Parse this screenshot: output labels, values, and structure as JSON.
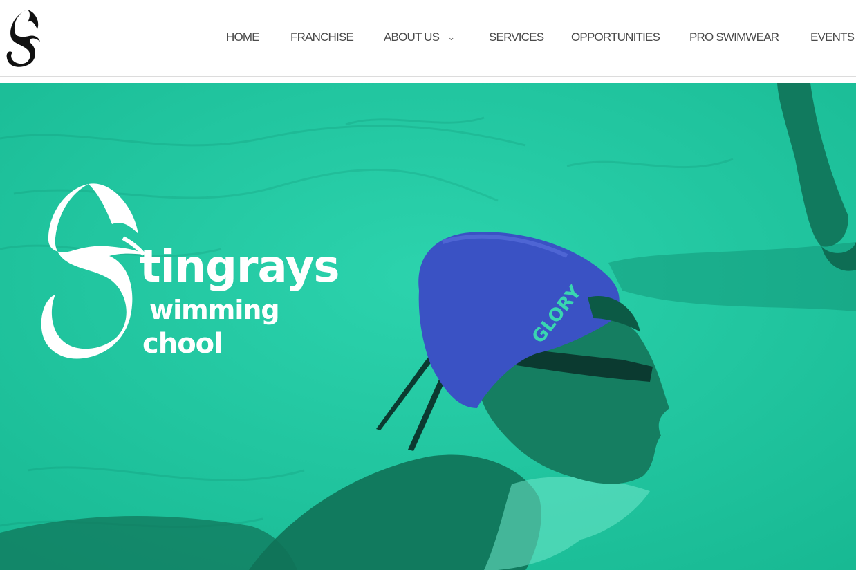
{
  "header": {
    "logo_icon": "stingray-s-logo-icon",
    "nav": [
      {
        "label": "HOME"
      },
      {
        "label": "FRANCHISE"
      },
      {
        "label": "ABOUT US",
        "has_dropdown": true,
        "dropdown_icon": "chevron-down-icon"
      },
      {
        "label": "SERVICES"
      },
      {
        "label": "OPPORTUNITIES"
      },
      {
        "label": "PRO SWIMWEAR"
      },
      {
        "label": "EVENTS"
      }
    ]
  },
  "hero": {
    "overlay_color": "#1fc7a0",
    "brand": {
      "word1": "tingrays",
      "word2": "wimming",
      "word3": "chool"
    },
    "cap_text": "GLORY",
    "image_description_icon": "swimmer-photo"
  },
  "colors": {
    "nav_text": "#4a4a4a",
    "teal": "#1fc7a0",
    "cap_blue": "#3a52c4"
  }
}
